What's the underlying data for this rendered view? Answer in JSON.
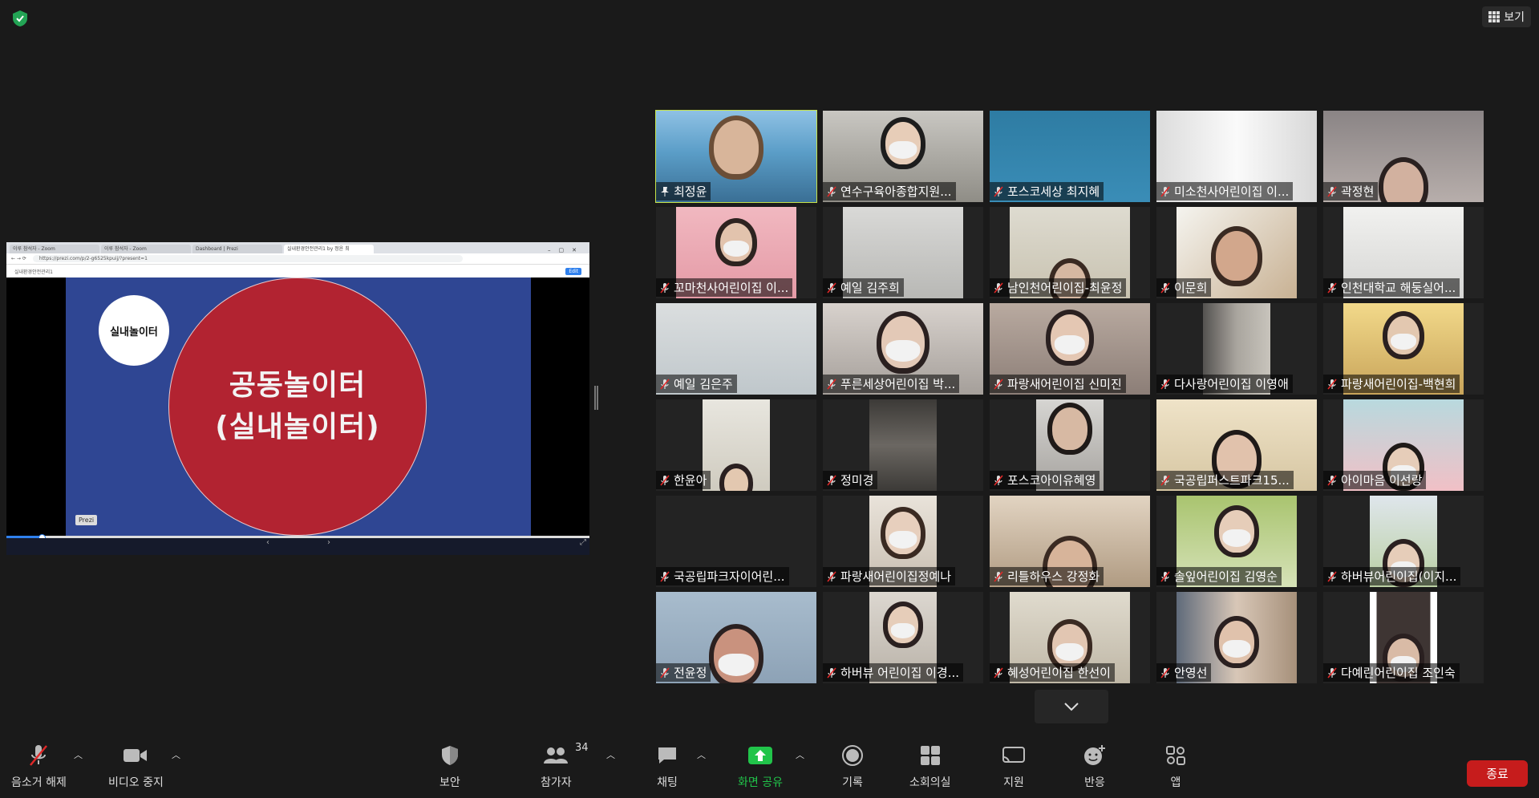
{
  "top_right": {
    "view_label": "보기"
  },
  "share": {
    "browser_tabs": [
      "이루 참석자 - Zoom",
      "이루 참석자 - Zoom",
      "Dashboard | Prezi",
      "실내환경안전관리1 by 정윤 최"
    ],
    "url": "https://prezi.com/p/2-g6525kpuij/?present=1",
    "prezi_title": "실내환경안전관리1",
    "edit_label": "Edit",
    "small_circle_text": "실내놀이터",
    "big_circle_line1": "공동놀이터",
    "big_circle_line2": "(실내놀이터)",
    "badge": "Prezi",
    "progress": 0.06
  },
  "participants": [
    {
      "name": "최정윤",
      "icon": "pin-icon",
      "active": true
    },
    {
      "name": "연수구육아종합지원...",
      "icon": "muted-mic-icon"
    },
    {
      "name": "포스코세상 최지혜",
      "icon": "muted-mic-icon"
    },
    {
      "name": "미소천사어린이집 이...",
      "icon": "muted-mic-icon"
    },
    {
      "name": "곽정현",
      "icon": "muted-mic-icon"
    },
    {
      "name": "꼬마천사어린이집 이...",
      "icon": "muted-mic-icon"
    },
    {
      "name": "예일 김주희",
      "icon": "muted-mic-icon"
    },
    {
      "name": "남인천어린이집-최윤정",
      "icon": "muted-mic-icon"
    },
    {
      "name": "이문희",
      "icon": "muted-mic-icon"
    },
    {
      "name": "인천대학교 해둥실어...",
      "icon": "muted-mic-icon"
    },
    {
      "name": "예일 김은주",
      "icon": "muted-mic-icon"
    },
    {
      "name": "푸른세상어린이집 박...",
      "icon": "muted-mic-icon"
    },
    {
      "name": "파랑새어린이집 신미진",
      "icon": "muted-mic-icon"
    },
    {
      "name": "다사랑어린이집 이영애",
      "icon": "muted-mic-icon"
    },
    {
      "name": "파랑새어린이집-백현희",
      "icon": "muted-mic-icon"
    },
    {
      "name": "한윤아",
      "icon": "muted-mic-icon"
    },
    {
      "name": "정미경",
      "icon": "muted-mic-icon"
    },
    {
      "name": "포스코아이유혜영",
      "icon": "muted-mic-icon"
    },
    {
      "name": "국공립퍼스트파크15...",
      "icon": "muted-mic-icon"
    },
    {
      "name": "아이마음 이선랑",
      "icon": "muted-mic-icon"
    },
    {
      "name": "국공립파크자이어린...",
      "icon": "muted-mic-icon"
    },
    {
      "name": "파랑새어린이집정예나",
      "icon": "muted-mic-icon"
    },
    {
      "name": "리틀하우스 강정화",
      "icon": "muted-mic-icon"
    },
    {
      "name": "솔잎어린이집 김영순",
      "icon": "muted-mic-icon"
    },
    {
      "name": "하버뷰어린이집(이지...",
      "icon": "muted-mic-icon"
    },
    {
      "name": "전윤정",
      "icon": "muted-mic-icon"
    },
    {
      "name": "하버뷰 어린이집 이경...",
      "icon": "muted-mic-icon"
    },
    {
      "name": "혜성어린이집 한선이",
      "icon": "muted-mic-icon"
    },
    {
      "name": "안영선",
      "icon": "muted-mic-icon"
    },
    {
      "name": "다예린어린이집 조인숙",
      "icon": "muted-mic-icon"
    }
  ],
  "toolbar": {
    "unmute": "음소거 해제",
    "stop_video": "비디오 중지",
    "security": "보안",
    "participants": "참가자",
    "participants_count": "34",
    "chat": "채팅",
    "share_screen": "화면 공유",
    "record": "기록",
    "breakout": "소회의실",
    "captions": "지원",
    "reactions": "반응",
    "apps": "앱",
    "end": "종료",
    "share_color": "#21c44a",
    "end_color": "#c61c1c"
  }
}
